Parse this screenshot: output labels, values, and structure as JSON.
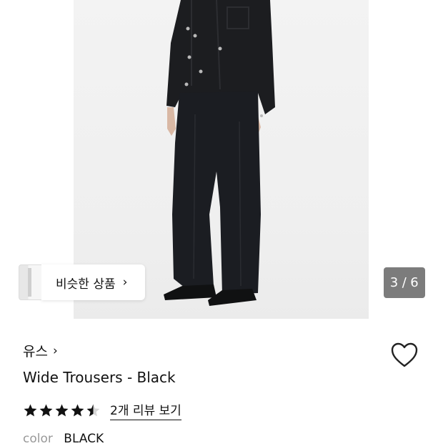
{
  "gallery": {
    "similar_label": "비슷한 상품",
    "chevron": "›",
    "current_page": "3",
    "page_separator": "/",
    "total_pages": "6"
  },
  "product": {
    "brand": "유스",
    "brand_chevron": "›",
    "name": "Wide Trousers - Black",
    "rating": 4.5,
    "rating_max": 5,
    "reviews_label": "2개 리뷰 보기",
    "color_label": "color",
    "color_value": "BLACK"
  },
  "icons": {
    "wishlist": "heart-outline-icon",
    "star": "star-icon"
  },
  "colors": {
    "text": "#111111",
    "muted": "#999999",
    "counter_bg": "#505050"
  }
}
